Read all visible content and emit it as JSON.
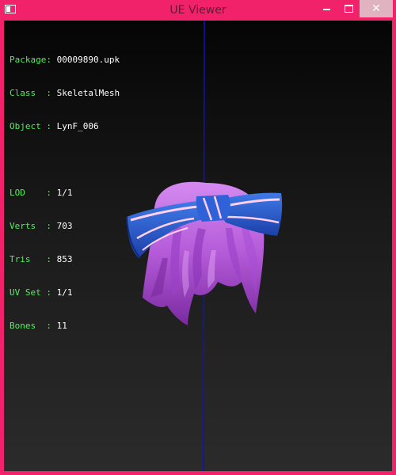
{
  "window": {
    "title": "UE Viewer",
    "icon": "app-window-icon",
    "controls": {
      "minimize": "minimize-icon",
      "maximize": "maximize-icon",
      "close": "✕"
    }
  },
  "colors": {
    "frame": "#f2226a",
    "label": "#4ff05a",
    "value": "#ffffff",
    "axis": "#1010c8",
    "hair": "#c06ae0",
    "ribbon": "#2a5fd0",
    "stripe": "#ffd0f0"
  },
  "info": {
    "package": {
      "label": "Package:",
      "value": "00009890.upk"
    },
    "class": {
      "label": "Class  :",
      "value": "SkeletalMesh"
    },
    "object": {
      "label": "Object :",
      "value": "LynF_006"
    },
    "lod": {
      "label": "LOD    :",
      "value": "1/1"
    },
    "verts": {
      "label": "Verts  :",
      "value": "703"
    },
    "tris": {
      "label": "Tris   :",
      "value": "853"
    },
    "uvset": {
      "label": "UV Set :",
      "value": "1/1"
    },
    "bones": {
      "label": "Bones  :",
      "value": "11"
    }
  }
}
